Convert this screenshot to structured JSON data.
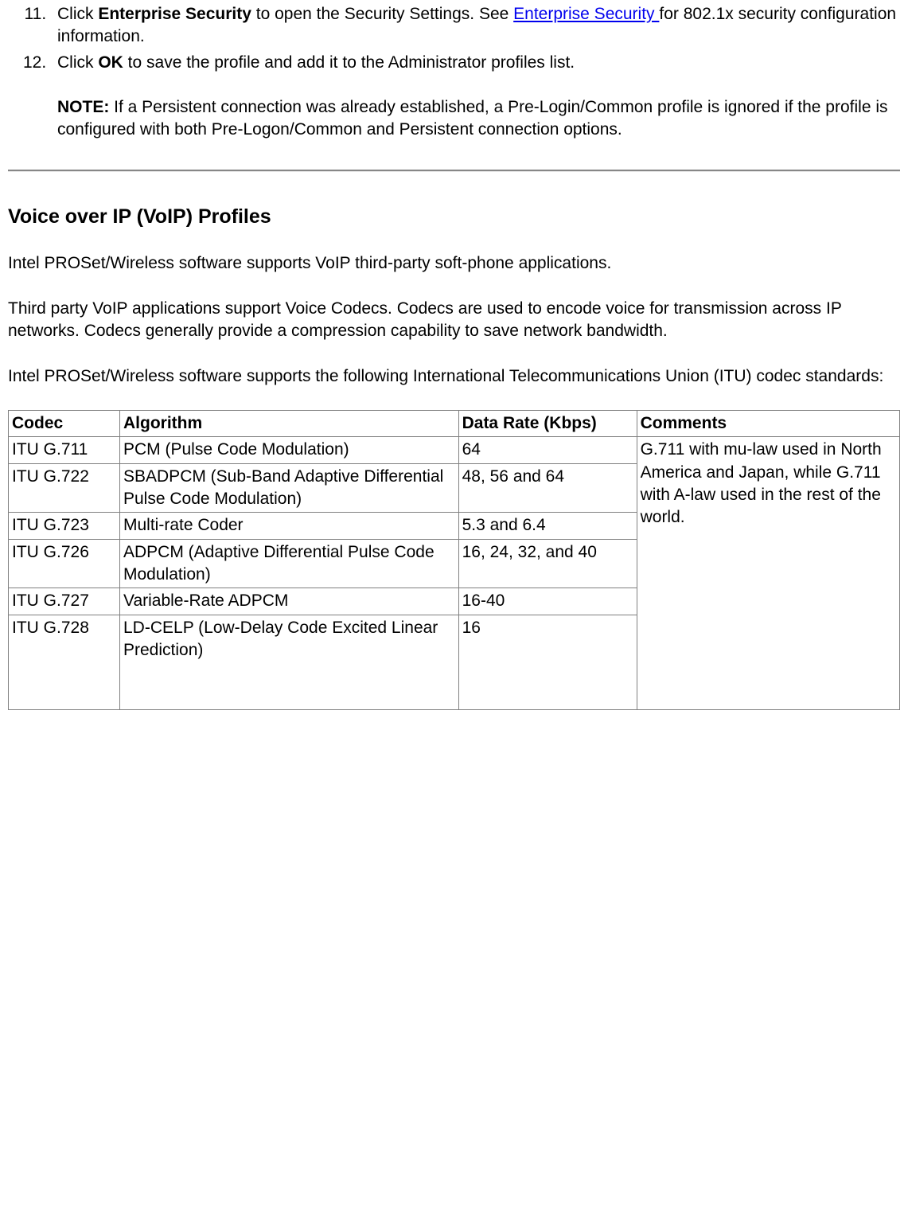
{
  "list": {
    "item11": {
      "prefix": "Click ",
      "bold1": "Enterprise Security",
      "mid1": " to open the Security Settings. See ",
      "link": "Enterprise Security ",
      "suffix1": "for 802.1x security configuration information."
    },
    "item12": {
      "prefix": "Click ",
      "bold1": "OK",
      "mid1": " to save the profile and add it to the Administrator profiles list.",
      "note_label": "NOTE:",
      "note_body": " If a Persistent connection was already established, a Pre-Login/Common profile is ignored if the profile is configured with both Pre-Logon/Common and Persistent connection options."
    }
  },
  "heading": "Voice over IP (VoIP) Profiles",
  "para1": "Intel PROSet/Wireless software supports VoIP third-party soft-phone applications.",
  "para2": "Third party VoIP applications support Voice Codecs. Codecs are used to encode voice for transmission across IP networks. Codecs generally provide a compression capability to save network bandwidth.",
  "para3": "Intel PROSet/Wireless software supports the following International Telecommunications Union (ITU) codec standards:",
  "table": {
    "headers": {
      "codec": "Codec",
      "algorithm": "Algorithm",
      "data_rate": "Data Rate (Kbps)",
      "comments": "Comments"
    },
    "rows": [
      {
        "codec": "ITU G.711",
        "algorithm": "PCM (Pulse Code Modulation)",
        "data_rate": "64",
        "comments": "G.711 with mu-law used in North America and Japan, while G.711 with A-law used in the rest of the world."
      },
      {
        "codec": "ITU G.722",
        "algorithm": "SBADPCM (Sub-Band Adaptive Differential Pulse Code Modulation)",
        "data_rate": "48, 56 and 64"
      },
      {
        "codec": "ITU G.723",
        "algorithm": "Multi-rate Coder",
        "data_rate": "5.3 and 6.4"
      },
      {
        "codec": "ITU G.726",
        "algorithm": "ADPCM (Adaptive Differential Pulse Code Modulation)",
        "data_rate": "16, 24, 32, and 40"
      },
      {
        "codec": "ITU G.727",
        "algorithm": "Variable-Rate ADPCM",
        "data_rate": "16-40"
      },
      {
        "codec": "ITU G.728",
        "algorithm": "LD-CELP (Low-Delay Code Excited Linear Prediction)",
        "data_rate": "16"
      }
    ]
  }
}
